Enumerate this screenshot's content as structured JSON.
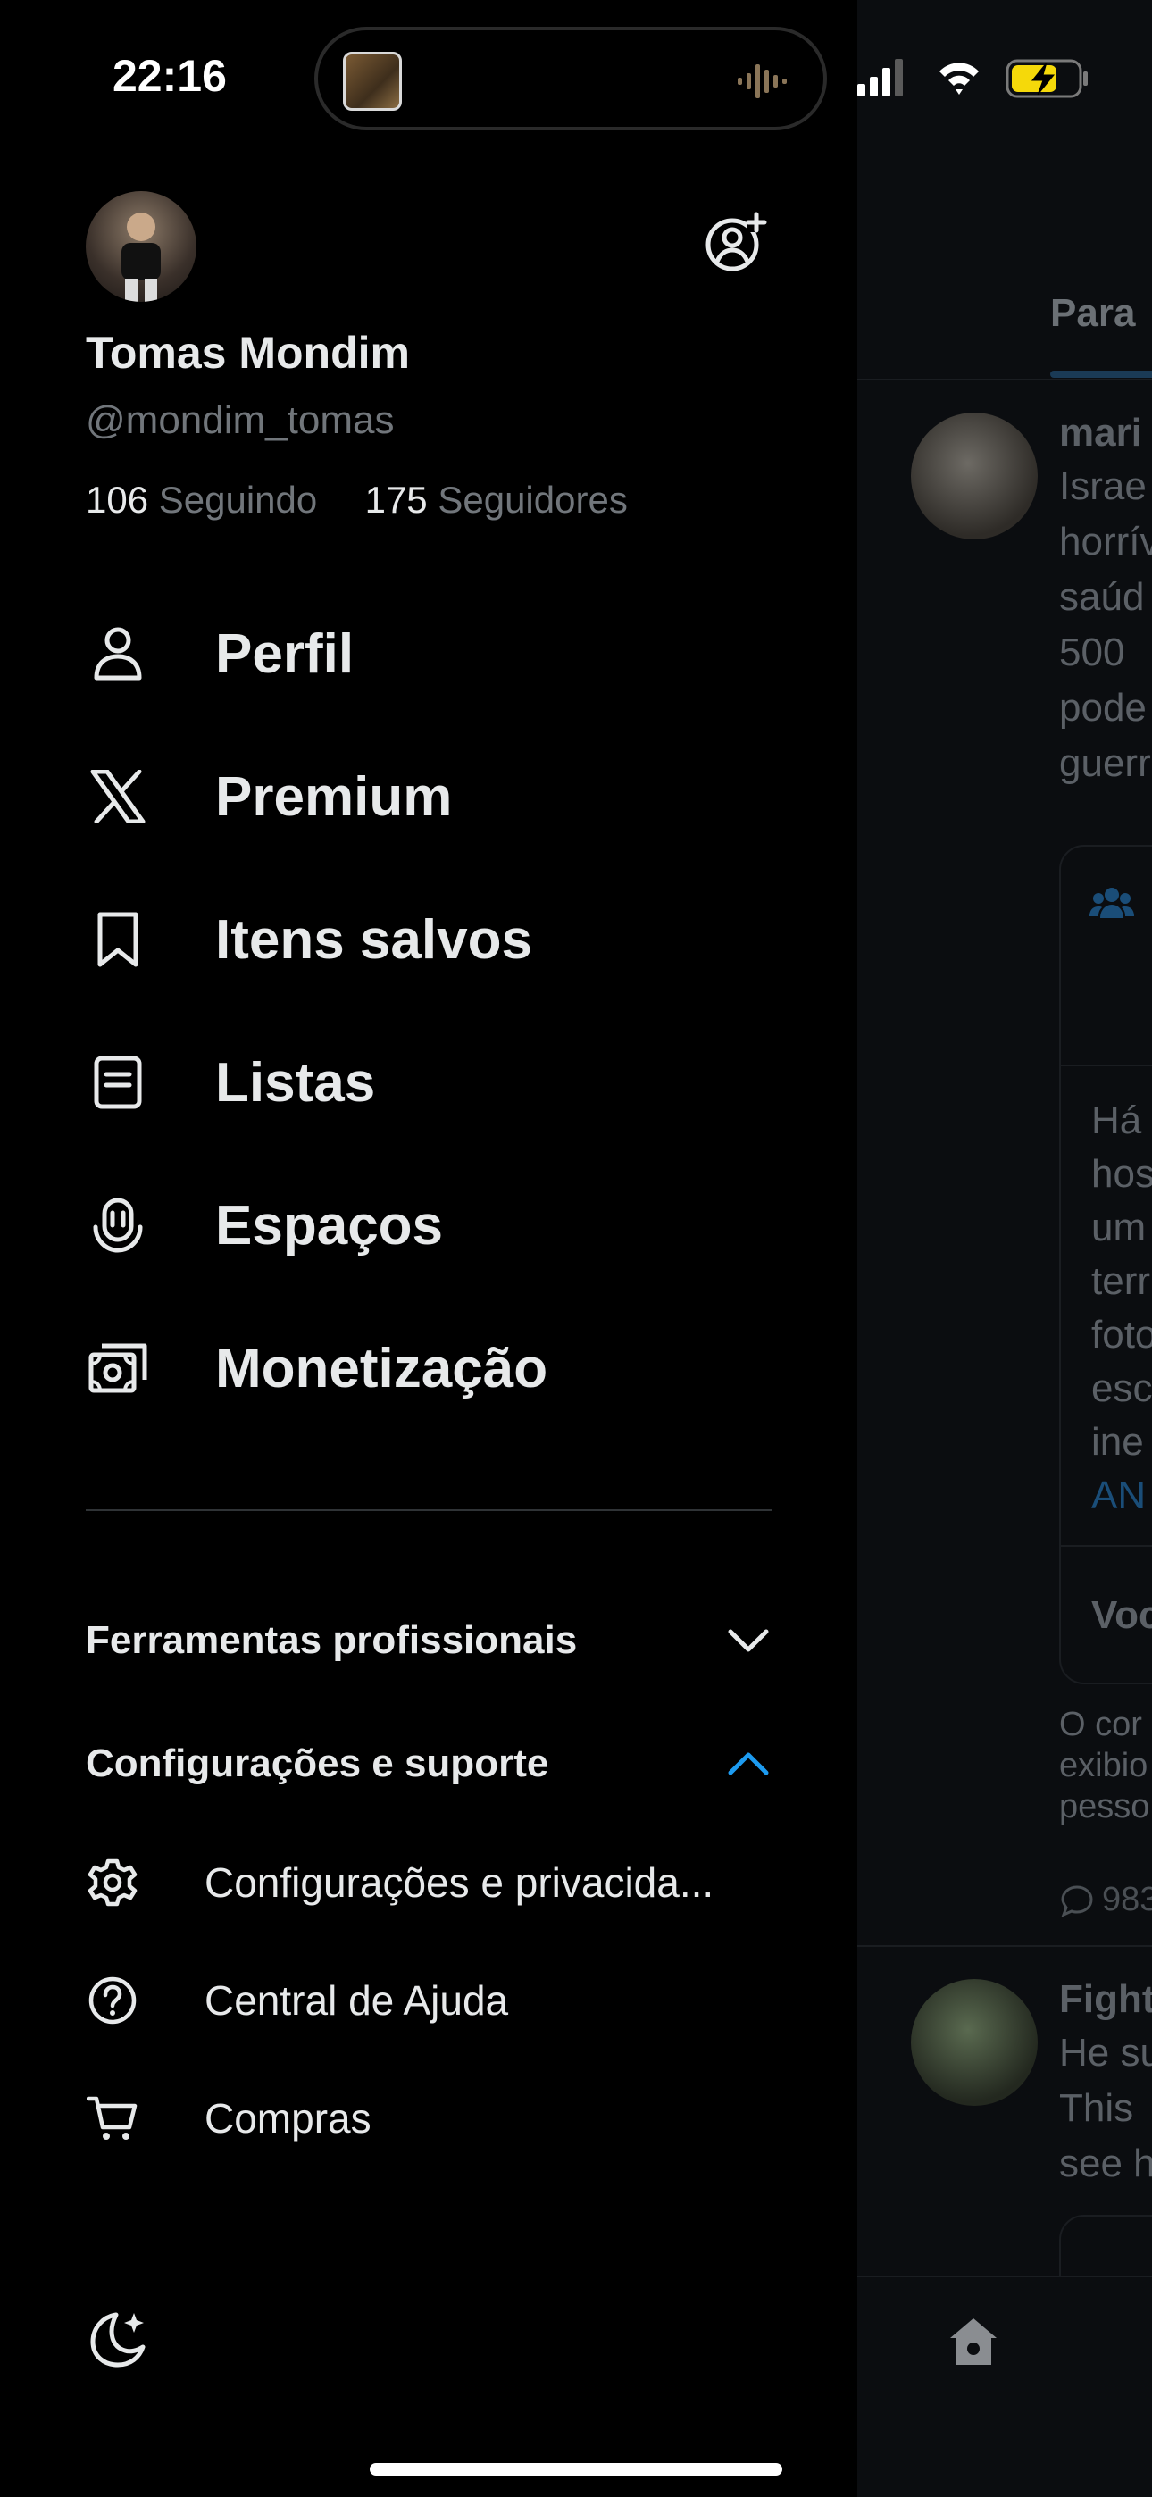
{
  "status_bar": {
    "time": "22:16"
  },
  "profile": {
    "name": "Tomas Mondim",
    "handle": "@mondim_tomas",
    "following_count": "106",
    "following_label": "Seguindo",
    "followers_count": "175",
    "followers_label": "Seguidores"
  },
  "menu": {
    "items": [
      {
        "label": "Perfil",
        "icon": "person-icon"
      },
      {
        "label": "Premium",
        "icon": "x-logo-icon"
      },
      {
        "label": "Itens salvos",
        "icon": "bookmark-icon"
      },
      {
        "label": "Listas",
        "icon": "list-icon"
      },
      {
        "label": "Espaços",
        "icon": "spaces-icon"
      },
      {
        "label": "Monetização",
        "icon": "money-icon"
      }
    ]
  },
  "sections": {
    "pro_tools": "Ferramentas profissionais",
    "settings_support": "Configurações e suporte"
  },
  "sub_items": [
    {
      "label": "Configurações e privacida...",
      "icon": "gear-icon"
    },
    {
      "label": "Central de Ajuda",
      "icon": "help-icon"
    },
    {
      "label": "Compras",
      "icon": "cart-icon"
    }
  ],
  "timeline": {
    "tab_label": "Para",
    "post1_name": "mari",
    "post1_lines": [
      "Israe",
      "horrív",
      "saúd",
      "500",
      "pode",
      "guerr"
    ],
    "card_lines": [
      "Há",
      "hos",
      "um",
      "terr",
      "foto",
      "esc",
      "ine"
    ],
    "card_link": "AN",
    "card_footer": "Voc",
    "note_lines": [
      "O cor",
      "exibio",
      "pesso"
    ],
    "reply_count": "983",
    "post2_name": "Fight",
    "post2_lines": [
      "He su",
      "This",
      "see h"
    ]
  },
  "colors": {
    "background": "#000000",
    "accent_blue": "#1d9bf0",
    "text_primary": "#e7e9ea",
    "text_secondary": "#71767b",
    "battery_yellow": "#f5d90a"
  }
}
